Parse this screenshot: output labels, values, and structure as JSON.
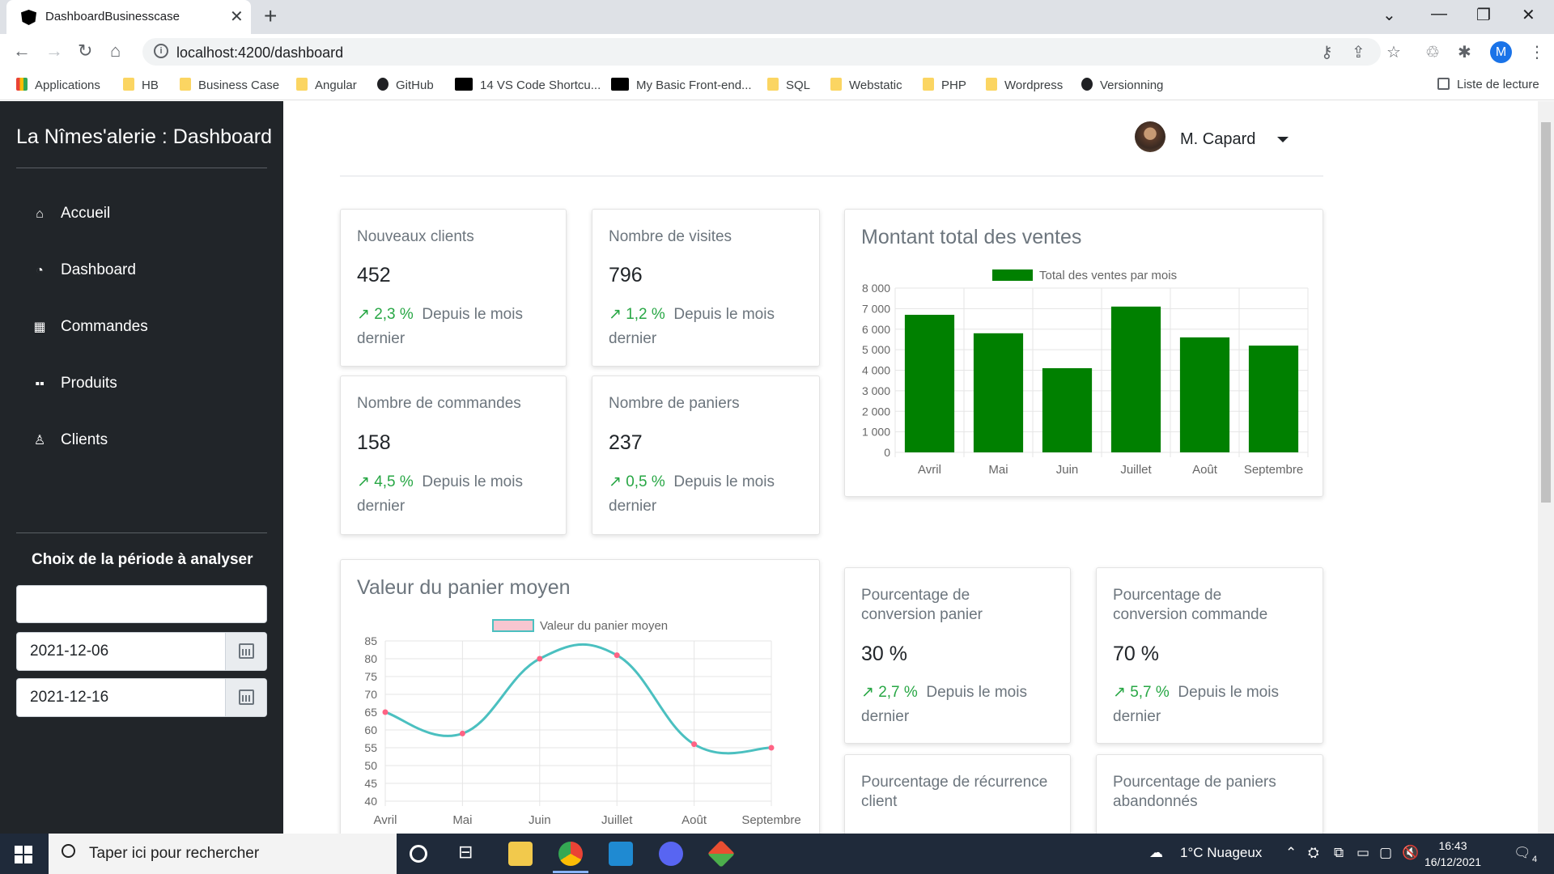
{
  "browser": {
    "tab_title": "DashboardBusinesscase",
    "url": "localhost:4200/dashboard",
    "profile_initial": "M",
    "bookmarks": [
      "Applications",
      "HB",
      "Business Case",
      "Angular",
      "GitHub",
      "14 VS Code Shortcu...",
      "My Basic Front-end...",
      "SQL",
      "Webstatic",
      "PHP",
      "Wordpress",
      "Versionning"
    ],
    "reading_list": "Liste de lecture"
  },
  "sidebar": {
    "brand": "La Nîmes'alerie : Dashboard",
    "items": [
      {
        "label": "Accueil",
        "icon": "home-icon"
      },
      {
        "label": "Dashboard",
        "icon": "speedometer-icon"
      },
      {
        "label": "Commandes",
        "icon": "table-icon"
      },
      {
        "label": "Produits",
        "icon": "grid-icon"
      },
      {
        "label": "Clients",
        "icon": "person-icon"
      }
    ],
    "period_title": "Choix de la période à analyser",
    "search_value": "",
    "date_start": "2021-12-06",
    "date_end": "2021-12-16"
  },
  "user": {
    "name": "M. Capard"
  },
  "kpis": {
    "clients": {
      "label": "Nouveaux clients",
      "value": "452",
      "pct": "2,3 %",
      "since": "Depuis le mois",
      "since2": "dernier"
    },
    "visites": {
      "label": "Nombre de visites",
      "value": "796",
      "pct": "1,2 %",
      "since": "Depuis le mois",
      "since2": "dernier"
    },
    "commandes": {
      "label": "Nombre de commandes",
      "value": "158",
      "pct": "4,5 %",
      "since": "Depuis le mois",
      "since2": "dernier"
    },
    "paniers": {
      "label": "Nombre de paniers",
      "value": "237",
      "pct": "0,5 %",
      "since": "Depuis le mois",
      "since2": "dernier"
    },
    "conv_panier": {
      "label1": "Pourcentage de",
      "label2": "conversion panier",
      "value": "30 %",
      "pct": "2,7 %",
      "since": "Depuis le mois",
      "since2": "dernier"
    },
    "conv_commande": {
      "label1": "Pourcentage de",
      "label2": "conversion commande",
      "value": "70 %",
      "pct": "5,7 %",
      "since": "Depuis le mois",
      "since2": "dernier"
    },
    "recurrence": {
      "label1": "Pourcentage de récurrence",
      "label2": "client"
    },
    "abandon": {
      "label1": "Pourcentage de paniers",
      "label2": "abandonnés"
    }
  },
  "colors": {
    "bar": "#008000",
    "line": "#4bc0c0",
    "point": "#ff6384",
    "trend": "#28a745",
    "sidebar": "#212529"
  },
  "chart_data": [
    {
      "type": "bar",
      "title": "Montant total des ventes",
      "categories": [
        "Avril",
        "Mai",
        "Juin",
        "Juillet",
        "Août",
        "Septembre"
      ],
      "series": [
        {
          "name": "Total des ventes par mois",
          "values": [
            6700,
            5800,
            4100,
            7100,
            5600,
            5200
          ]
        }
      ],
      "ylim": [
        0,
        8000
      ],
      "yticks": [
        "8 000",
        "7 000",
        "6 000",
        "5 000",
        "4 000",
        "3 000",
        "2 000",
        "1 000",
        "0"
      ],
      "grid": true,
      "legend": "top-center"
    },
    {
      "type": "line",
      "title": "Valeur du panier moyen",
      "categories": [
        "Avril",
        "Mai",
        "Juin",
        "Juillet",
        "Août",
        "Septembre"
      ],
      "series": [
        {
          "name": "Valeur du panier moyen",
          "values": [
            65,
            59,
            80,
            81,
            56,
            55
          ]
        }
      ],
      "ylim": [
        40,
        85
      ],
      "yticks": [
        "85",
        "80",
        "75",
        "70",
        "65",
        "60",
        "55",
        "50",
        "45",
        "40"
      ],
      "grid": true,
      "legend": "top-center"
    }
  ],
  "taskbar": {
    "search_placeholder": "Taper ici pour rechercher",
    "weather": "1°C  Nuageux",
    "time": "16:43",
    "date": "16/12/2021",
    "notif_count": "4"
  }
}
